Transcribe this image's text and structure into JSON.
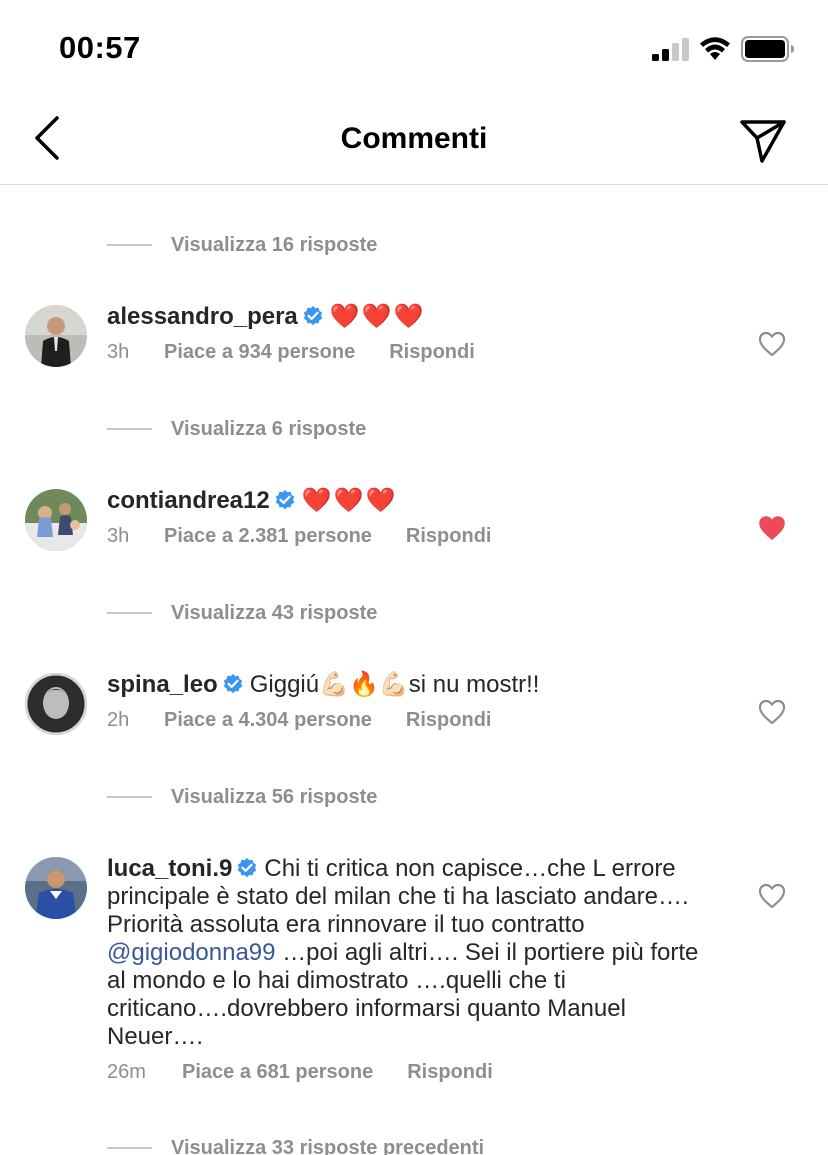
{
  "status_bar": {
    "time": "00:57"
  },
  "header": {
    "title": "Commenti"
  },
  "comments_section": {
    "view_replies": [
      {
        "label": "Visualizza 16 risposte"
      },
      {
        "label": "Visualizza 6 risposte"
      },
      {
        "label": "Visualizza 43 risposte"
      },
      {
        "label": "Visualizza 56 risposte"
      },
      {
        "label": "Visualizza 33 risposte precedenti"
      }
    ],
    "comments": [
      {
        "username": "alessandro_pera",
        "text": "❤️❤️❤️",
        "time": "3h",
        "likes": "Piace a 934 persone",
        "reply": "Rispondi",
        "liked": false
      },
      {
        "username": "contiandrea12",
        "text": "❤️❤️❤️",
        "time": "3h",
        "likes": "Piace a 2.381 persone",
        "reply": "Rispondi",
        "liked": true
      },
      {
        "username": "spina_leo",
        "text": "Giggiú💪🏻🔥💪🏻si nu mostr!!",
        "time": "2h",
        "likes": "Piace a 4.304 persone",
        "reply": "Rispondi",
        "liked": false
      },
      {
        "username": "luca_toni.9",
        "text_before": "Chi ti critica non capisce…che L errore principale è stato del milan che ti ha lasciato andare…. Priorità assoluta era rinnovare il tuo contratto ",
        "mention": "@gigiodonna99",
        "text_after": " …poi agli altri…. Sei il portiere più forte al mondo e lo hai dimostrato ….quelli che ti criticano….dovrebbero informarsi quanto Manuel Neuer….",
        "time": "26m",
        "likes": "Piace a 681 persone",
        "reply": "Rispondi",
        "liked": false
      }
    ]
  },
  "icons": {
    "back": "chevron-left-icon",
    "send": "paper-plane-icon",
    "verified": "verified-badge-icon",
    "like": "heart-icon"
  },
  "colors": {
    "verified": "#3897f0",
    "liked_heart": "#ed4956",
    "muted_text": "#8e8e8e",
    "mention": "#385898"
  }
}
